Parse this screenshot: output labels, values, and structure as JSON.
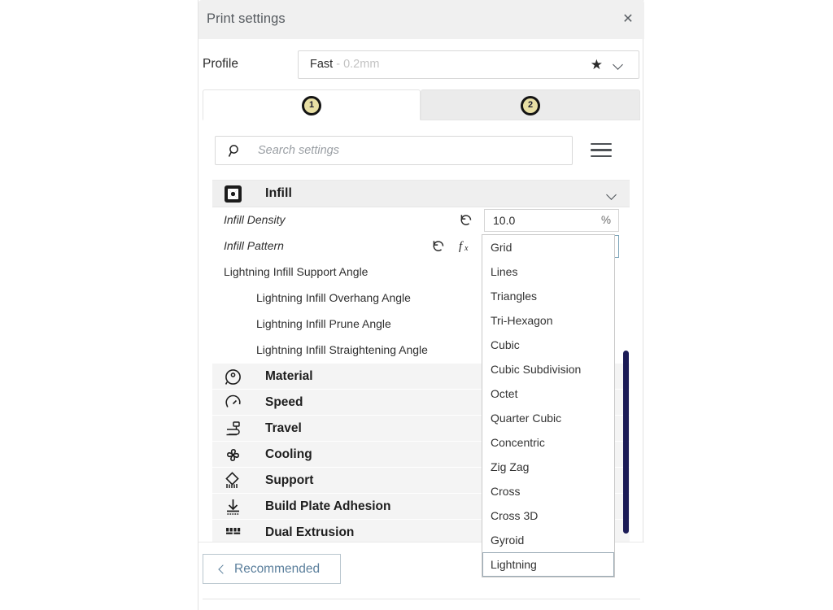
{
  "window": {
    "title": "Print settings",
    "close_icon": "close-icon"
  },
  "profile": {
    "label": "Profile",
    "value": "Fast",
    "sub_value": " - 0.2mm",
    "star_icon": "star-icon",
    "caret_icon": "chevron-down-icon"
  },
  "tabs": [
    {
      "badge": "1",
      "name": "tab-custom",
      "active": true
    },
    {
      "badge": "2",
      "name": "tab-secondary",
      "active": false
    }
  ],
  "search": {
    "placeholder": "Search settings",
    "value": "",
    "search_icon": "search-icon",
    "menu_icon": "hamburger-menu-icon"
  },
  "section": {
    "icon": "infill-icon",
    "title": "Infill",
    "collapse_icon": "chevron-down-icon"
  },
  "settings": [
    {
      "label": "Infill Density",
      "italic": true,
      "indent": 0,
      "has_revert": true,
      "has_fx": false,
      "value": "10.0",
      "unit": "%",
      "control": "text",
      "focused": false
    },
    {
      "label": "Infill Pattern",
      "italic": true,
      "indent": 0,
      "has_revert": true,
      "has_fx": true,
      "value": "Lightning",
      "unit": "",
      "control": "select",
      "focused": true
    },
    {
      "label": "Lightning Infill Support Angle",
      "italic": false,
      "indent": 0,
      "has_revert": false,
      "has_fx": false,
      "value": "",
      "unit": "",
      "control": "none",
      "focused": false
    },
    {
      "label": "Lightning Infill Overhang Angle",
      "italic": false,
      "indent": 1,
      "has_revert": false,
      "has_fx": false,
      "value": "",
      "unit": "",
      "control": "none",
      "focused": false
    },
    {
      "label": "Lightning Infill Prune Angle",
      "italic": false,
      "indent": 1,
      "has_revert": false,
      "has_fx": false,
      "value": "",
      "unit": "",
      "control": "none",
      "focused": false
    },
    {
      "label": "Lightning Infill Straightening Angle",
      "italic": false,
      "indent": 1,
      "has_revert": false,
      "has_fx": false,
      "value": "",
      "unit": "",
      "control": "none",
      "focused": false
    }
  ],
  "categories": [
    {
      "label": "Material",
      "icon": "material-spool-icon"
    },
    {
      "label": "Speed",
      "icon": "speedometer-icon"
    },
    {
      "label": "Travel",
      "icon": "travel-path-icon"
    },
    {
      "label": "Cooling",
      "icon": "fan-icon"
    },
    {
      "label": "Support",
      "icon": "support-icon"
    },
    {
      "label": "Build Plate Adhesion",
      "icon": "build-plate-adhesion-icon"
    },
    {
      "label": "Dual Extrusion",
      "icon": "dual-extrusion-icon"
    }
  ],
  "dropdown": {
    "selected": "Lightning",
    "options": [
      "Grid",
      "Lines",
      "Triangles",
      "Tri-Hexagon",
      "Cubic",
      "Cubic Subdivision",
      "Octet",
      "Quarter Cubic",
      "Concentric",
      "Zig Zag",
      "Cross",
      "Cross 3D",
      "Gyroid",
      "Lightning"
    ]
  },
  "bottom": {
    "recommended_label": "Recommended",
    "back_icon": "chevron-left-icon"
  },
  "scrollbar": {
    "thumb_name": "settings-scrollbar-thumb"
  },
  "colors": {
    "titlebar_bg": "#f0f0f0",
    "accent_link": "#5b7f9c",
    "scrollbar_thumb": "#1b1b56",
    "badge_fill": "#e8dfa4",
    "section_bg": "#efefef",
    "category_bg": "#f4f4f4"
  }
}
